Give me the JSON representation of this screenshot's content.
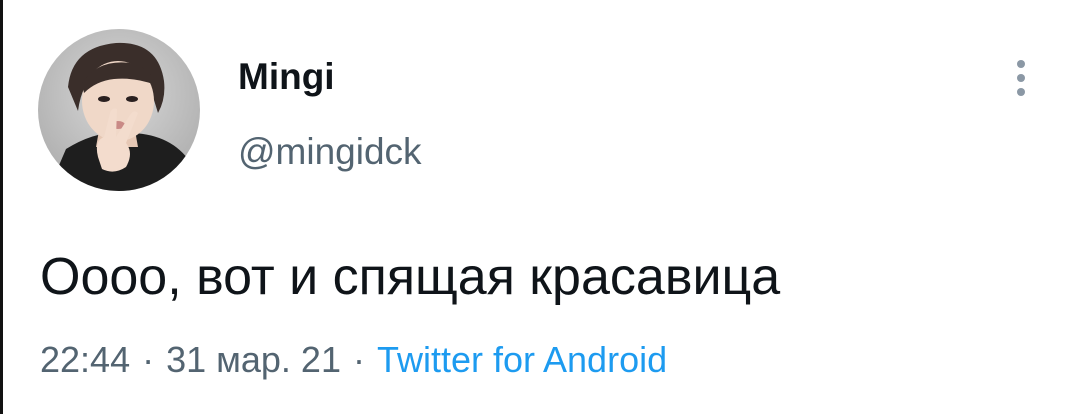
{
  "tweet": {
    "author": {
      "display_name": "Mingi",
      "handle": "@mingidck",
      "avatar_icon": "profile-photo"
    },
    "more_icon": "vertical-ellipsis-icon",
    "text": "Оооо, вот и спящая красавица",
    "meta": {
      "time": "22:44",
      "separator": "·",
      "date": "31 мар. 21",
      "source": "Twitter for Android"
    }
  },
  "colors": {
    "text_primary": "#0f1419",
    "text_secondary": "#536471",
    "link": "#1d9bf0",
    "icon_gray": "#8b98a5"
  }
}
